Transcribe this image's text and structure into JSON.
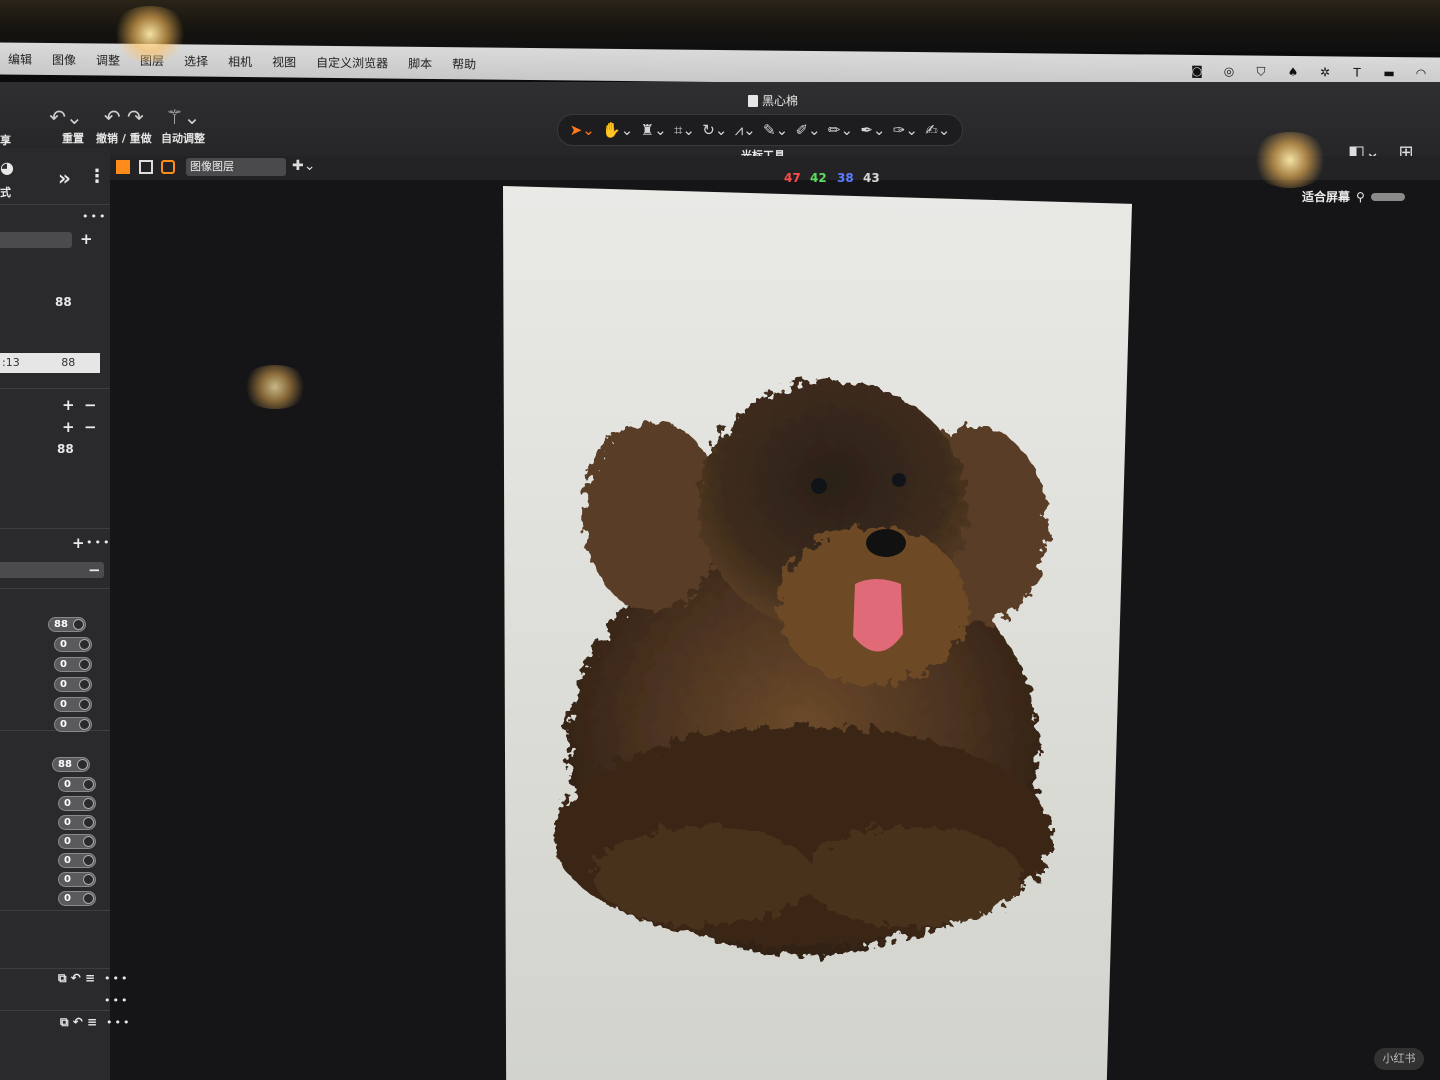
{
  "menubar": {
    "items": [
      "编辑",
      "图像",
      "调整",
      "图层",
      "选择",
      "相机",
      "视图",
      "自定义浏览器",
      "脚本",
      "帮助"
    ]
  },
  "toolbar": {
    "reset_label": "重置",
    "undo_redo_label": "撤销 / 重做",
    "auto_adjust_label": "自动调整",
    "document_title": "黑心棉",
    "cursor_tools_label": "光标工具",
    "before_label": "之前",
    "grid_label": "网格"
  },
  "viewer": {
    "layer_select_value": "图像图层",
    "rgb": {
      "r": "47",
      "g": "42",
      "b": "38",
      "a": "43"
    },
    "fit_label": "适合屏幕",
    "colors": {
      "red": "#ff4a4a",
      "green": "#5ddc5d",
      "blue": "#5a7cff",
      "accent": "#ff8c1a"
    }
  },
  "sidebar": {
    "value_a": "88",
    "row_time": ":13",
    "row_value": "88",
    "value_b": "88",
    "toggles_group1": [
      "88",
      "0",
      "0",
      "0",
      "0",
      "0"
    ],
    "toggles_group2": [
      "88",
      "0",
      "0",
      "0",
      "0",
      "0",
      "0",
      "0"
    ],
    "more": "•••",
    "label_top": "享",
    "label_mode": "式"
  },
  "watermark": "小红书"
}
